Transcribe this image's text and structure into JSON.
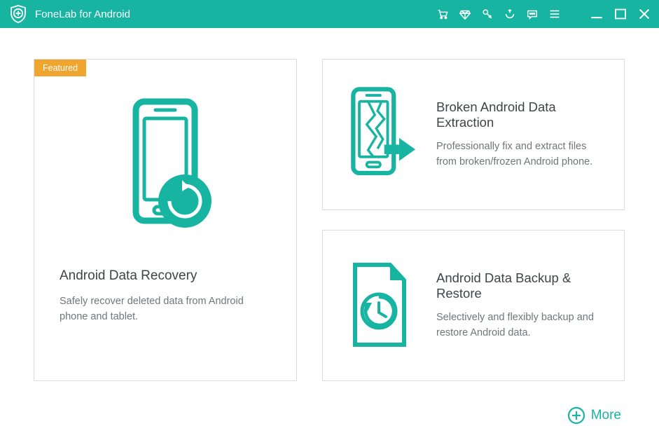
{
  "colors": {
    "accent": "#17b4a1",
    "badge": "#f0a52e"
  },
  "app": {
    "title": "FoneLab for Android"
  },
  "titlebarIcons": {
    "cart": "cart-icon",
    "diamond": "diamond-icon",
    "key": "key-icon",
    "refresh": "refresh-icon",
    "chat": "chat-icon",
    "menu": "menu-icon"
  },
  "windowControls": {
    "min": "minimize",
    "max": "maximize",
    "close": "close"
  },
  "cards": {
    "recovery": {
      "badge": "Featured",
      "title": "Android Data Recovery",
      "desc": "Safely recover deleted data from Android phone and tablet."
    },
    "broken": {
      "title": "Broken Android Data Extraction",
      "desc": "Professionally fix and extract files from broken/frozen Android phone."
    },
    "backup": {
      "title": "Android Data Backup & Restore",
      "desc": "Selectively and flexibly backup and restore Android data."
    }
  },
  "more": {
    "label": "More"
  }
}
